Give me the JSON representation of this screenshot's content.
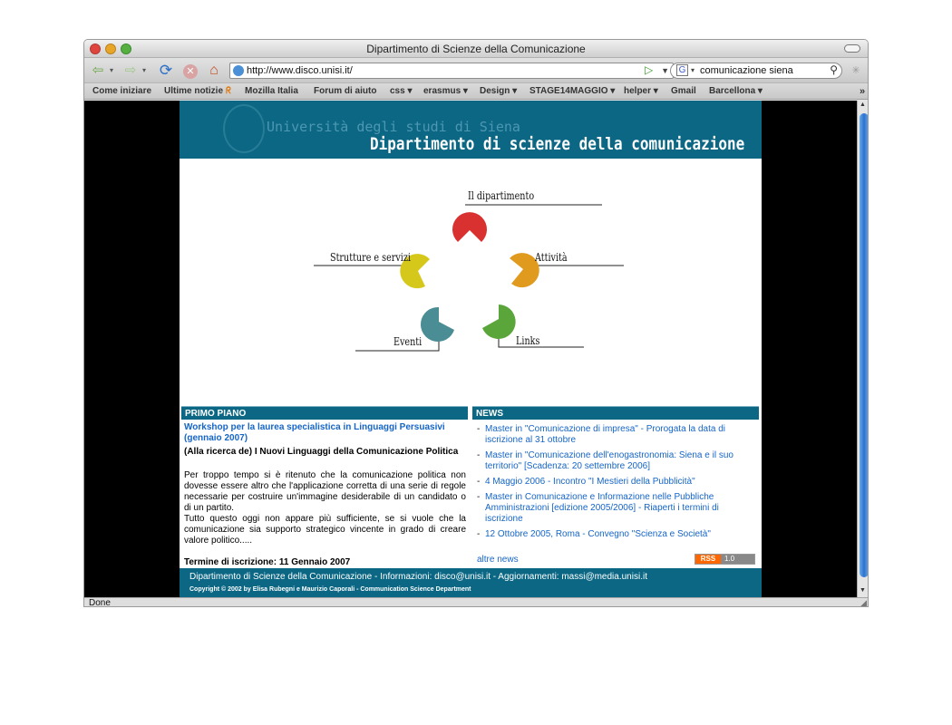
{
  "window": {
    "title": "Dipartimento di Scienze della Comunicazione"
  },
  "navbar": {
    "url": "http://www.disco.unisi.it/",
    "search_value": "comunicazione siena",
    "search_engine_label": "G"
  },
  "bookmarks": [
    {
      "label": "Come iniziare"
    },
    {
      "label": "Ultime notizie"
    },
    {
      "label": "Mozilla Italia"
    },
    {
      "label": "Forum di aiuto"
    },
    {
      "label": "css ▾"
    },
    {
      "label": "erasmus ▾"
    },
    {
      "label": "Design ▾"
    },
    {
      "label": "STAGE14MAGGIO ▾"
    },
    {
      "label": "helper ▾"
    },
    {
      "label": "Gmail"
    },
    {
      "label": "Barcellona ▾"
    }
  ],
  "page": {
    "banner": {
      "university": "Università degli studi di Siena",
      "department": "Dipartimento di scienze della comunicazione"
    },
    "menu": [
      {
        "label": "Il dipartimento",
        "color": "#d93030"
      },
      {
        "label": "Attività",
        "color": "#e09a1e"
      },
      {
        "label": "Links",
        "color": "#5aa63a"
      },
      {
        "label": "Eventi",
        "color": "#4a8d95"
      },
      {
        "label": "Strutture e servizi",
        "color": "#d6c81a"
      }
    ],
    "primo_piano": {
      "heading": "PRIMO PIANO",
      "link": "Workshop per la laurea specialistica in Linguaggi Persuasivi (gennaio 2007)",
      "subtitle": "(Alla ricerca de) I Nuovi Linguaggi della Comunicazione Politica",
      "body1": "Per troppo tempo si è ritenuto che la comunicazione politica non dovesse essere altro che l'applicazione corretta di una serie di regole necessarie per costruire un'immagine desiderabile di un candidato o di un partito.",
      "body2": "Tutto questo oggi non appare più sufficiente, se si vuole che la comunicazione sia supporto strategico vincente in grado di creare valore politico.....",
      "deadline": "Termine di iscrizione: 11 Gennaio 2007"
    },
    "news": {
      "heading": "NEWS",
      "items": [
        "Master in \"Comunicazione di impresa\" - Prorogata la data di iscrizione al 31 ottobre",
        "Master in \"Comunicazione dell'enogastronomia: Siena e il suo territorio\" [Scadenza: 20 settembre 2006]",
        "4 Maggio 2006 - Incontro \"I Mestieri della Pubblicità\"",
        "Master in Comunicazione e Informazione nelle Pubbliche Amministrazioni [edizione 2005/2006] - Riaperti i termini di iscrizione",
        "12 Ottobre 2005, Roma - Convegno \"Scienza e Società\""
      ],
      "more": "altre news",
      "rss_left": "RSS",
      "rss_right": "1.0"
    },
    "footer": {
      "line1": "Dipartimento di Scienze della Comunicazione - Informazioni: disco@unisi.it - Aggiornamenti: massi@media.unisi.it",
      "line2": "Copyright © 2002 by Elisa Rubegni e Maurizio Caporali - Communication Science Department"
    }
  },
  "status": {
    "text": "Done"
  }
}
